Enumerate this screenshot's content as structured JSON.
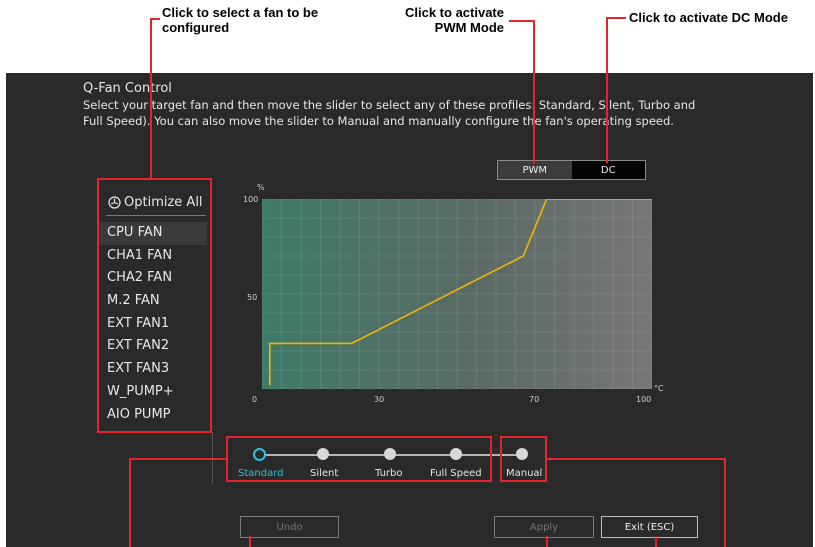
{
  "callouts": {
    "select_fan": "Click to select a fan to be\nconfigured",
    "pwm": "Click to activate\nPWM Mode",
    "dc": "Click to activate DC Mode"
  },
  "header": {
    "title": "Q-Fan Control",
    "description": "Select your target fan and then move the slider to select any of these profiles: Standard, Silent, Turbo and Full Speed). You can also move the slider to Manual and manually configure the fan's operating speed."
  },
  "mode": {
    "pwm_label": "PWM",
    "dc_label": "DC",
    "active": "PWM"
  },
  "fan_list": {
    "optimize_label": "Optimize All",
    "items": [
      "CPU FAN",
      "CHA1 FAN",
      "CHA2 FAN",
      "M.2 FAN",
      "EXT FAN1",
      "EXT FAN2",
      "EXT FAN3",
      "W_PUMP+",
      "AIO PUMP"
    ],
    "selected": "CPU FAN"
  },
  "chart": {
    "y_unit": "%",
    "x_unit": "°C",
    "y_ticks": [
      "100",
      "50"
    ],
    "x_ticks": [
      "0",
      "30",
      "70",
      "100"
    ]
  },
  "chart_data": {
    "type": "line",
    "xlabel": "°C",
    "ylabel": "%",
    "xlim": [
      0,
      100
    ],
    "ylim": [
      0,
      100
    ],
    "series": [
      {
        "x": [
          2,
          2,
          23,
          67,
          73,
          100
        ],
        "y": [
          2,
          24,
          24,
          70,
          100,
          100
        ]
      }
    ],
    "line_color": "#f4b400",
    "grid": true
  },
  "profiles": {
    "items": [
      "Standard",
      "Silent",
      "Turbo",
      "Full Speed"
    ],
    "manual_label": "Manual",
    "selected": "Standard"
  },
  "buttons": {
    "undo": "Undo",
    "apply": "Apply",
    "exit": "Exit (ESC)"
  },
  "colors": {
    "callout_red": "#e3262d",
    "accent": "#29c2e0",
    "curve": "#f4b400"
  }
}
